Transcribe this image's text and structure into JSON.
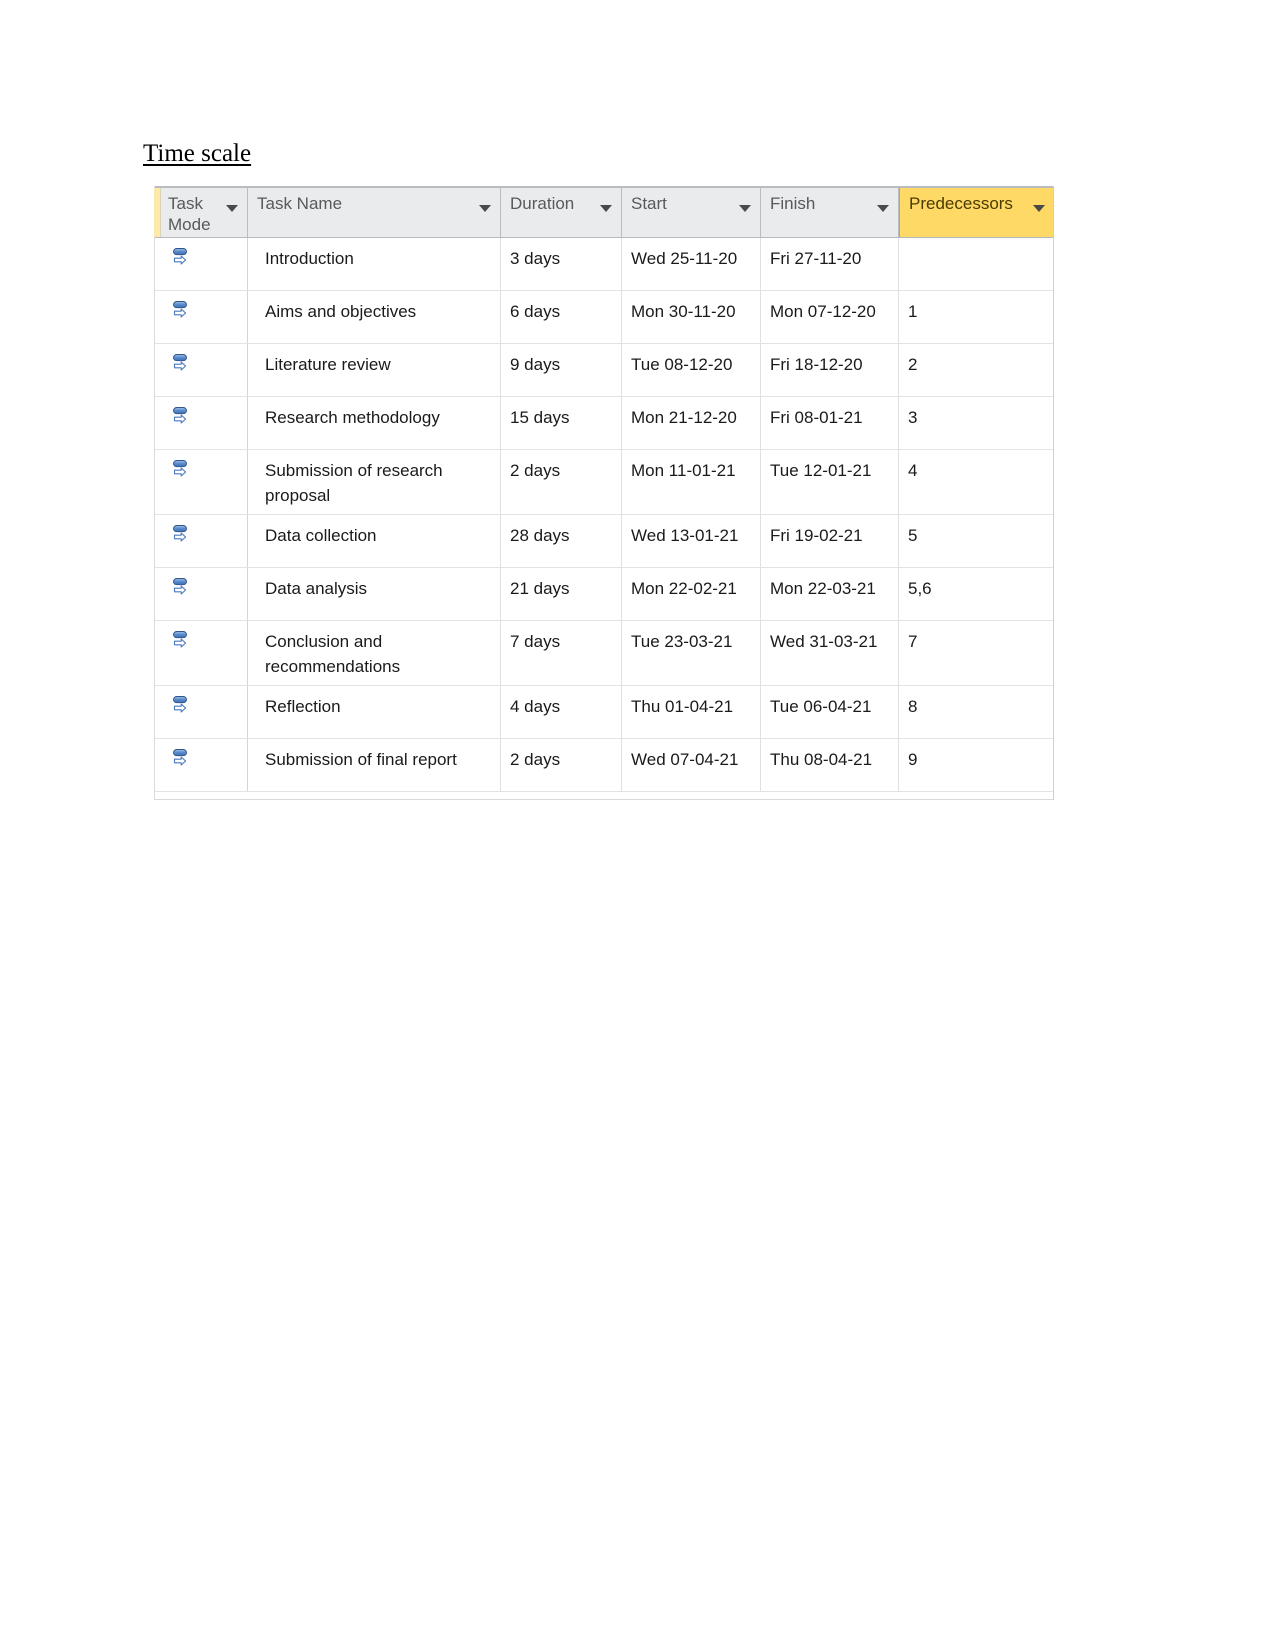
{
  "page": {
    "heading": "Time scale"
  },
  "grid": {
    "columns": [
      {
        "key": "mode",
        "label": "Task Mode",
        "icon": "chevron-down-icon",
        "highlight": false
      },
      {
        "key": "name",
        "label": "Task Name",
        "icon": "chevron-down-icon",
        "highlight": false
      },
      {
        "key": "duration",
        "label": "Duration",
        "icon": "chevron-down-icon",
        "highlight": false
      },
      {
        "key": "start",
        "label": "Start",
        "icon": "chevron-down-icon",
        "highlight": false
      },
      {
        "key": "finish",
        "label": "Finish",
        "icon": "chevron-down-icon",
        "highlight": false
      },
      {
        "key": "predecessors",
        "label": "Predecessors",
        "icon": "chevron-down-icon",
        "highlight": true
      }
    ],
    "highlight_color": "#ffd966",
    "header_color": "#e9ebed",
    "task_mode_icon": "auto-scheduled-icon",
    "rows": [
      {
        "mode": "auto-scheduled-icon",
        "name": "Introduction",
        "duration": "3 days",
        "start": "Wed 25-11-20",
        "finish": "Fri 27-11-20",
        "predecessors": ""
      },
      {
        "mode": "auto-scheduled-icon",
        "name": "Aims and objectives",
        "duration": "6 days",
        "start": "Mon 30-11-20",
        "finish": "Mon 07-12-20",
        "predecessors": "1"
      },
      {
        "mode": "auto-scheduled-icon",
        "name": "Literature review",
        "duration": "9 days",
        "start": "Tue 08-12-20",
        "finish": "Fri 18-12-20",
        "predecessors": "2"
      },
      {
        "mode": "auto-scheduled-icon",
        "name": "Research methodology",
        "duration": "15 days",
        "start": "Mon 21-12-20",
        "finish": "Fri 08-01-21",
        "predecessors": "3"
      },
      {
        "mode": "auto-scheduled-icon",
        "name": "Submission of research proposal",
        "duration": "2 days",
        "start": "Mon 11-01-21",
        "finish": "Tue 12-01-21",
        "predecessors": "4"
      },
      {
        "mode": "auto-scheduled-icon",
        "name": "Data collection",
        "duration": "28 days",
        "start": "Wed 13-01-21",
        "finish": "Fri 19-02-21",
        "predecessors": "5"
      },
      {
        "mode": "auto-scheduled-icon",
        "name": "Data analysis",
        "duration": "21 days",
        "start": "Mon 22-02-21",
        "finish": "Mon 22-03-21",
        "predecessors": "5,6"
      },
      {
        "mode": "auto-scheduled-icon",
        "name": "Conclusion and recommendations",
        "duration": "7 days",
        "start": "Tue 23-03-21",
        "finish": "Wed 31-03-21",
        "predecessors": "7"
      },
      {
        "mode": "auto-scheduled-icon",
        "name": "Reflection",
        "duration": "4 days",
        "start": "Thu 01-04-21",
        "finish": "Tue 06-04-21",
        "predecessors": "8"
      },
      {
        "mode": "auto-scheduled-icon",
        "name": "Submission of final report",
        "duration": "2 days",
        "start": "Wed 07-04-21",
        "finish": "Thu 08-04-21",
        "predecessors": "9"
      }
    ]
  }
}
